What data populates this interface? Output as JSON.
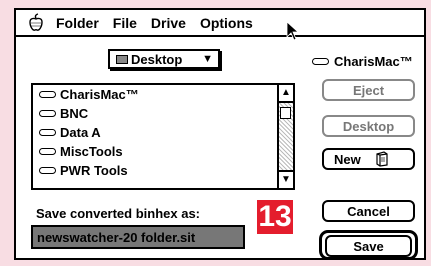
{
  "menubar": {
    "items": [
      "Folder",
      "File",
      "Drive",
      "Options"
    ]
  },
  "folder_popup": {
    "label": "Desktop",
    "icon": "folder-icon"
  },
  "file_list": {
    "items": [
      {
        "label": "CharisMac™",
        "icon": "disk-icon"
      },
      {
        "label": "BNC",
        "icon": "disk-icon"
      },
      {
        "label": "Data A",
        "icon": "disk-icon"
      },
      {
        "label": "MiscTools",
        "icon": "disk-icon"
      },
      {
        "label": "PWR Tools",
        "icon": "disk-icon"
      }
    ]
  },
  "volume": {
    "name": "CharisMac™"
  },
  "buttons": {
    "eject": "Eject",
    "desktop": "Desktop",
    "new": "New",
    "cancel": "Cancel",
    "save": "Save"
  },
  "save_prompt": "Save converted binhex as:",
  "filename": "newswatcher-20 folder.sit",
  "badge": "13",
  "colors": {
    "badge": "#e41d2d",
    "background": "#f8dde3",
    "field_highlight": "#777777"
  }
}
